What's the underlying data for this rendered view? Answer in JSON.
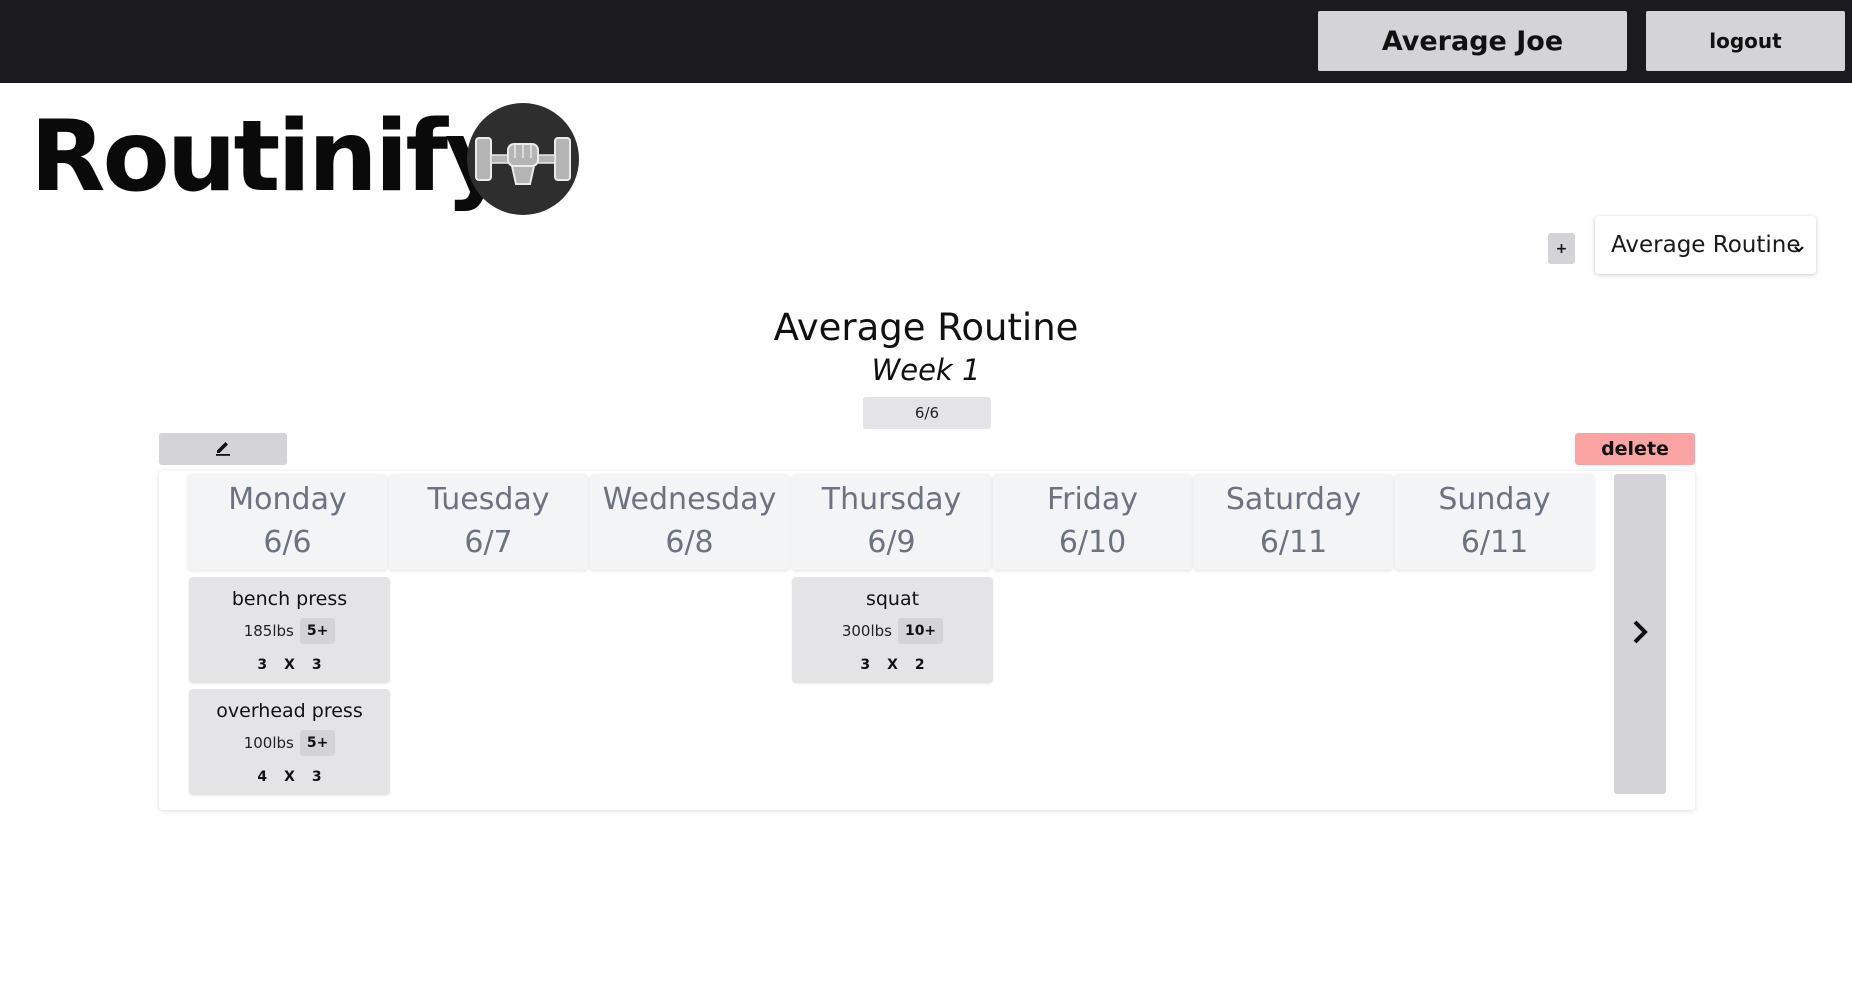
{
  "header": {
    "user_label": "Average Joe",
    "logout_label": "logout"
  },
  "brand": {
    "name": "Routinify",
    "logo_icon": "dumbbell-fist-icon"
  },
  "routine_controls": {
    "add_label": "+",
    "selected_routine": "Average Routine",
    "selected_routine_options": [
      "Average Routine"
    ]
  },
  "routine": {
    "title": "Average Routine",
    "week": "Week 1",
    "current_date": "6/6",
    "edit_icon": "pencil-icon",
    "delete_label": "delete"
  },
  "days": [
    {
      "name": "Monday",
      "date": "6/6",
      "exercises": [
        {
          "name": "bench press",
          "weight": "185lbs",
          "amrap": "5+",
          "sets": "3",
          "x": "X",
          "reps": "3"
        },
        {
          "name": "overhead press",
          "weight": "100lbs",
          "amrap": "5+",
          "sets": "4",
          "x": "X",
          "reps": "3"
        }
      ]
    },
    {
      "name": "Tuesday",
      "date": "6/7",
      "exercises": []
    },
    {
      "name": "Wednesday",
      "date": "6/8",
      "exercises": []
    },
    {
      "name": "Thursday",
      "date": "6/9",
      "exercises": [
        {
          "name": "squat",
          "weight": "300lbs",
          "amrap": "10+",
          "sets": "3",
          "x": "X",
          "reps": "2"
        }
      ]
    },
    {
      "name": "Friday",
      "date": "6/10",
      "exercises": []
    },
    {
      "name": "Saturday",
      "date": "6/11",
      "exercises": []
    },
    {
      "name": "Sunday",
      "date": "6/11",
      "exercises": []
    }
  ],
  "navigation": {
    "next_icon": "chevron-right-icon"
  },
  "colors": {
    "topbar": "#1b1a1f",
    "button": "#d4d4d8",
    "delete": "#f9a3a3",
    "day_header": "#f3f4f6",
    "exercise_card": "#e4e4e7"
  }
}
